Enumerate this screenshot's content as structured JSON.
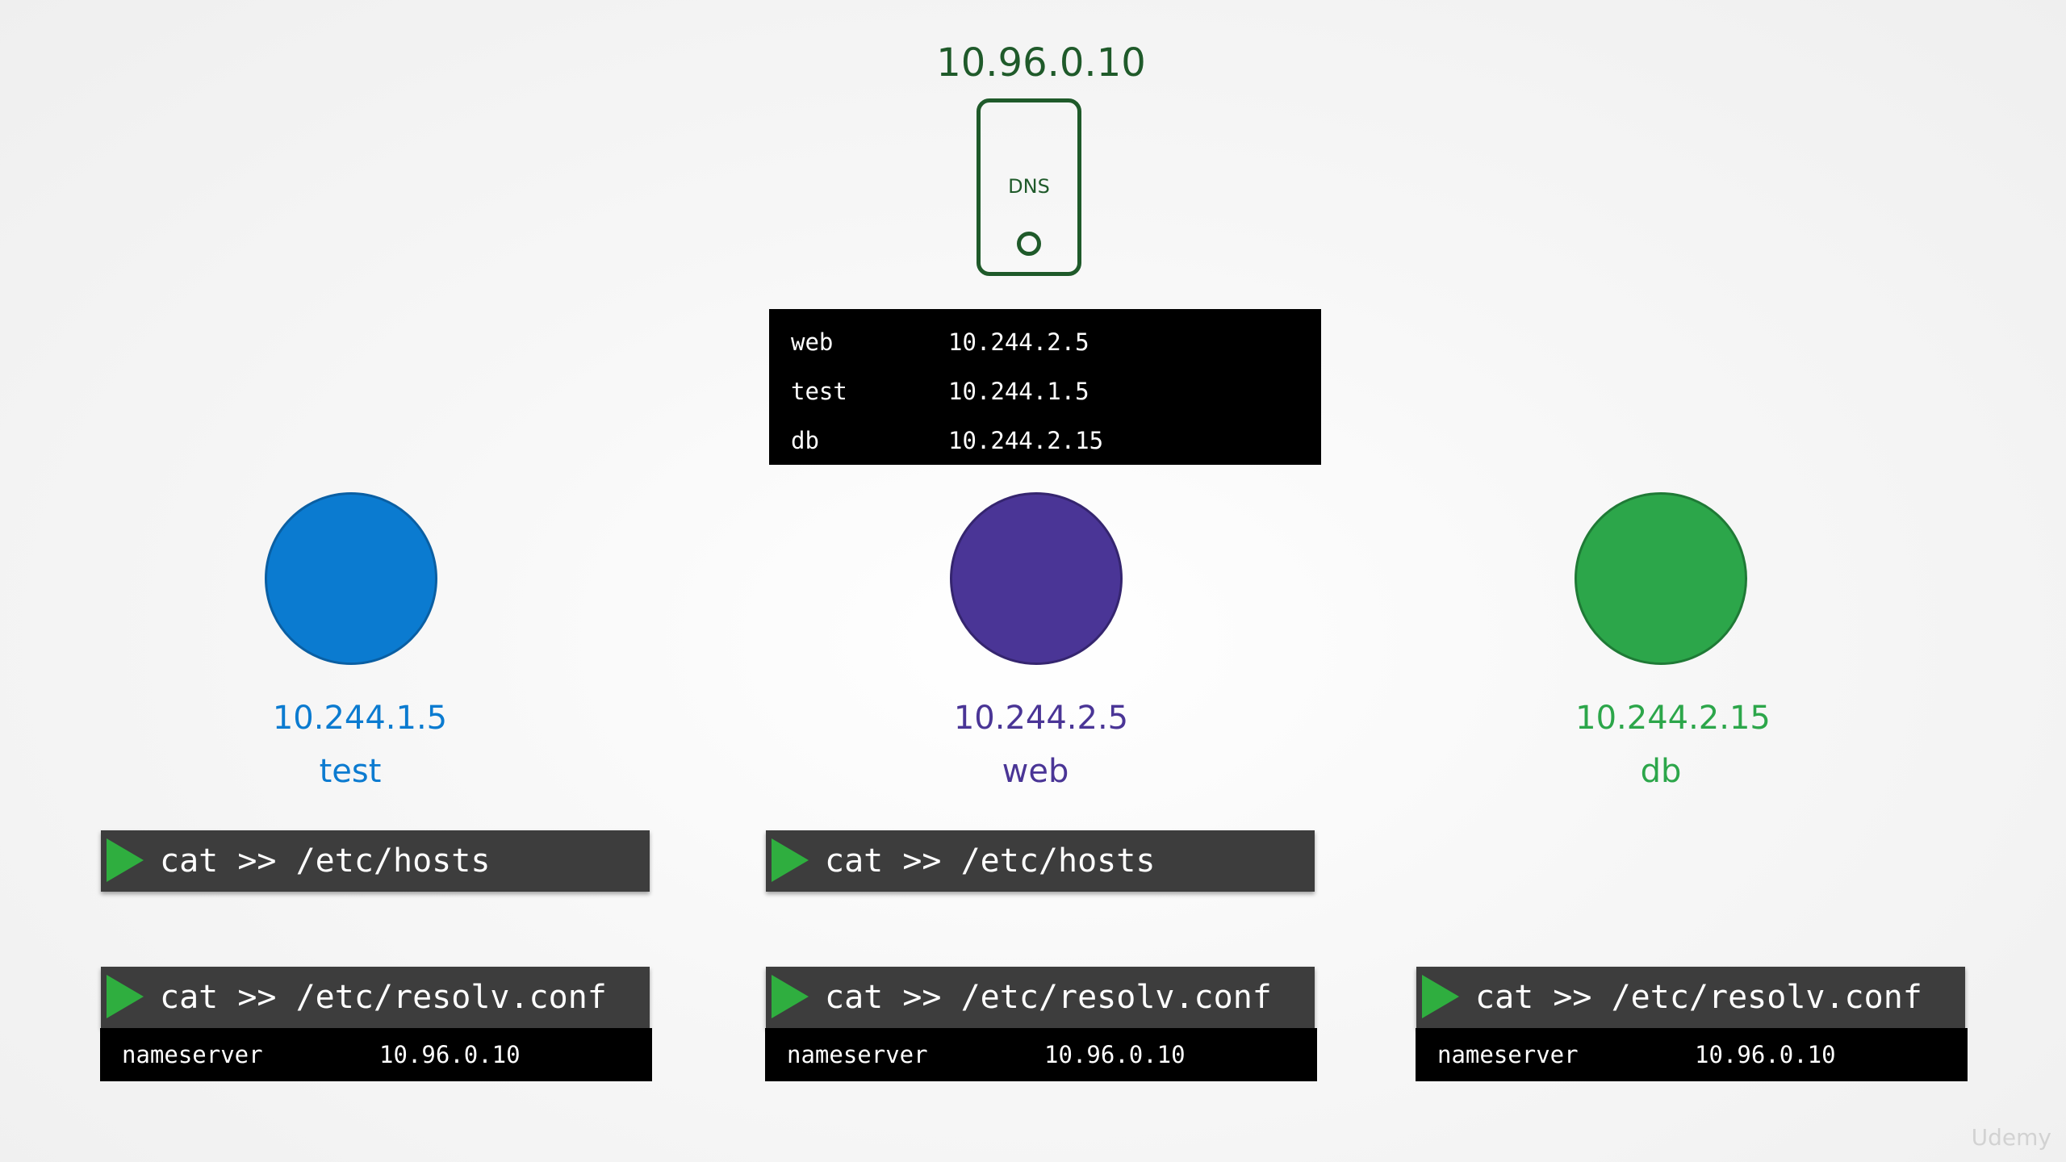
{
  "dns": {
    "ip": "10.96.0.10",
    "label": "DNS",
    "records": [
      {
        "name": "web",
        "ip": "10.244.2.5"
      },
      {
        "name": "test",
        "ip": "10.244.1.5"
      },
      {
        "name": "db",
        "ip": "10.244.2.15"
      }
    ]
  },
  "pods": {
    "test": {
      "ip": "10.244.1.5",
      "name": "test",
      "color": "#0b7bd0"
    },
    "web": {
      "ip": "10.244.2.5",
      "name": "web",
      "color": "#4a3596"
    },
    "db": {
      "ip": "10.244.2.15",
      "name": "db",
      "color": "#2ca64a"
    }
  },
  "commands": {
    "hosts": "cat >> /etc/hosts",
    "resolv": "cat >> /etc/resolv.conf"
  },
  "resolv_output": {
    "key": "nameserver",
    "value": "10.96.0.10"
  },
  "watermark": "Udemy"
}
